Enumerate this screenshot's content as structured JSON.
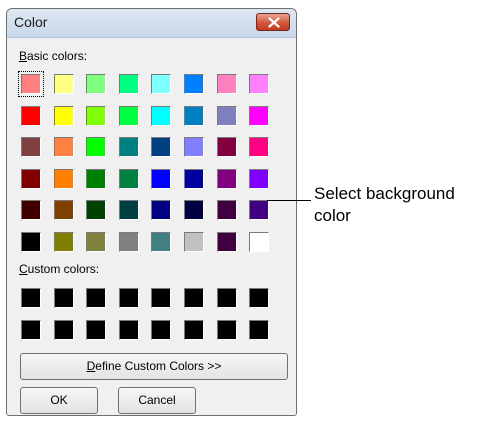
{
  "window": {
    "title": "Color",
    "close_icon": "close-x-icon"
  },
  "basic_colors": {
    "label_mnemonic": "B",
    "label_rest": "asic colors:",
    "selected_index": 0,
    "rows": [
      [
        "#ff8080",
        "#ffff80",
        "#80ff80",
        "#00ff80",
        "#80ffff",
        "#0080ff",
        "#ff80c0",
        "#ff80ff"
      ],
      [
        "#ff0000",
        "#ffff00",
        "#80ff00",
        "#00ff40",
        "#00ffff",
        "#0080c0",
        "#8080c0",
        "#ff00ff"
      ],
      [
        "#804040",
        "#ff8040",
        "#00ff00",
        "#008080",
        "#004080",
        "#8080ff",
        "#800040",
        "#ff0080"
      ],
      [
        "#800000",
        "#ff8000",
        "#008000",
        "#008040",
        "#0000ff",
        "#0000a0",
        "#800080",
        "#8000ff"
      ],
      [
        "#400000",
        "#804000",
        "#004000",
        "#004040",
        "#000080",
        "#000040",
        "#400040",
        "#400080"
      ],
      [
        "#000000",
        "#808000",
        "#808040",
        "#808080",
        "#408080",
        "#c0c0c0",
        "#400040",
        "#ffffff"
      ]
    ]
  },
  "custom_colors": {
    "label_mnemonic": "C",
    "label_rest": "ustom colors:",
    "rows": [
      [
        "#000000",
        "#000000",
        "#000000",
        "#000000",
        "#000000",
        "#000000",
        "#000000",
        "#000000"
      ],
      [
        "#000000",
        "#000000",
        "#000000",
        "#000000",
        "#000000",
        "#000000",
        "#000000",
        "#000000"
      ]
    ]
  },
  "buttons": {
    "define_mnemonic": "D",
    "define_rest": "efine Custom Colors >>",
    "ok": "OK",
    "cancel": "Cancel"
  },
  "callout": {
    "line1": "Select background",
    "line2": "color"
  }
}
